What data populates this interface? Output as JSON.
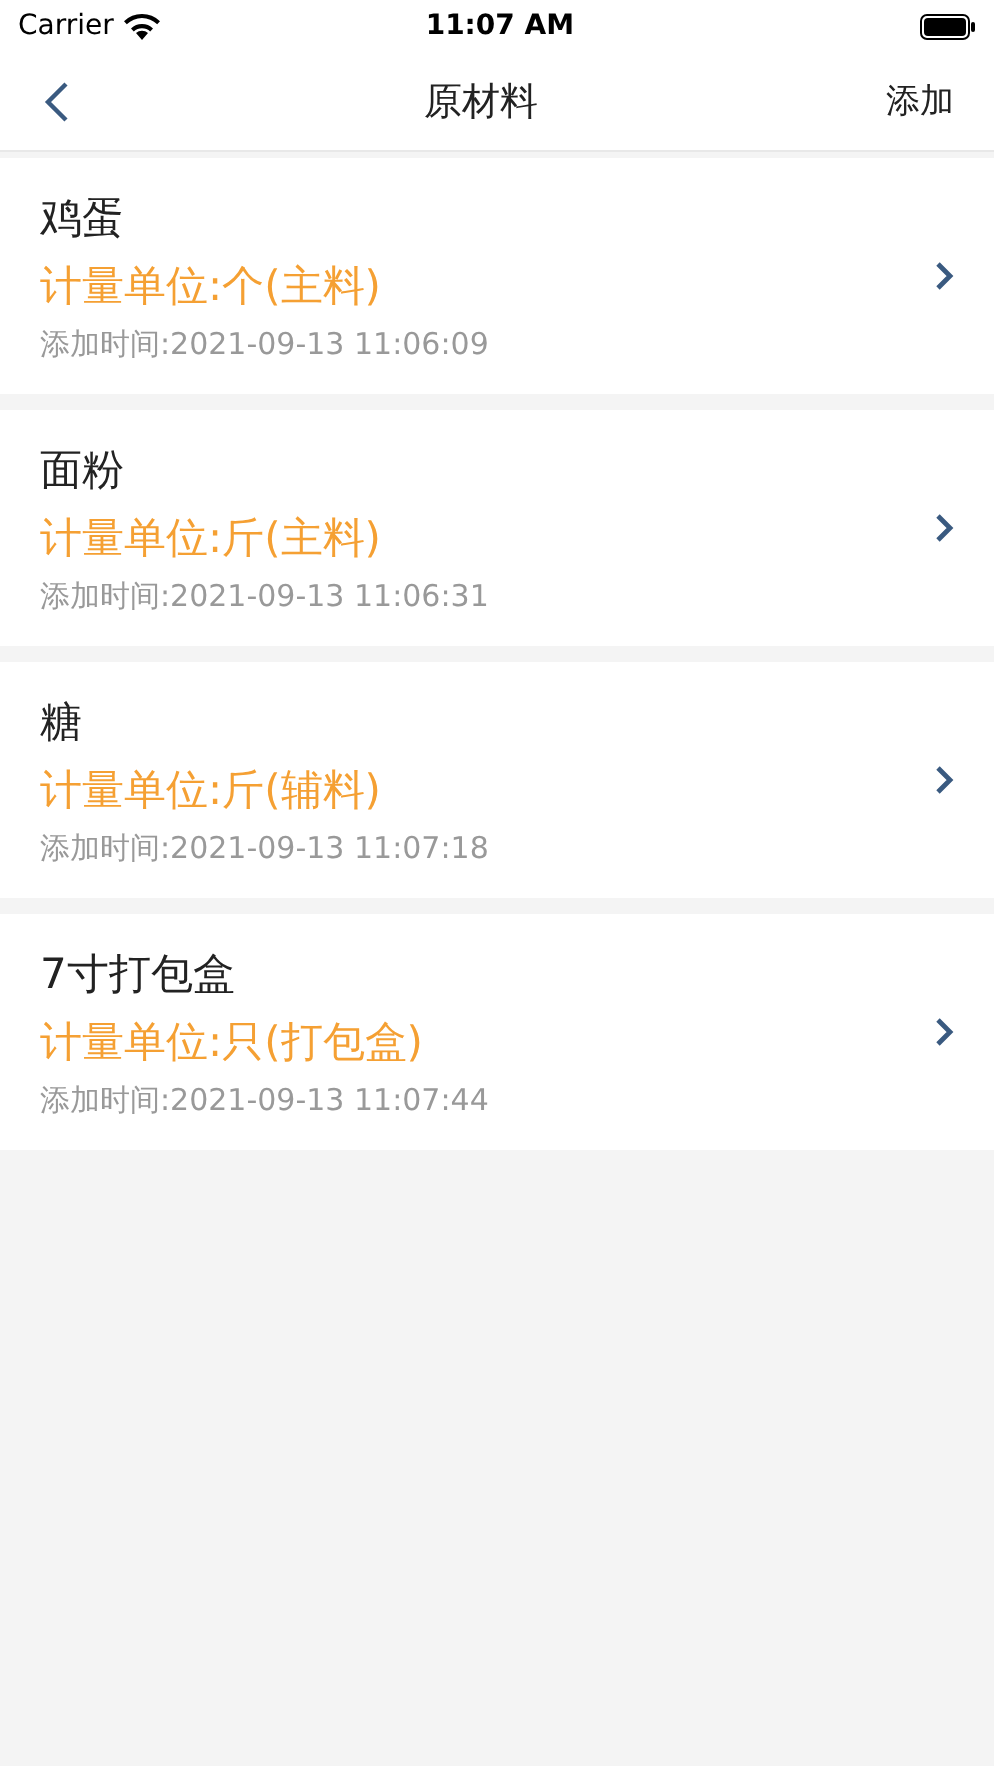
{
  "status_bar": {
    "carrier": "Carrier",
    "time": "11:07 AM"
  },
  "nav": {
    "title": "原材料",
    "action": "添加"
  },
  "items": [
    {
      "name": "鸡蛋",
      "unit": "计量单位:个(主料)",
      "time": "添加时间:2021-09-13 11:06:09"
    },
    {
      "name": "面粉",
      "unit": "计量单位:斤(主料)",
      "time": "添加时间:2021-09-13 11:06:31"
    },
    {
      "name": "糖",
      "unit": "计量单位:斤(辅料)",
      "time": "添加时间:2021-09-13 11:07:18"
    },
    {
      "name": "7寸打包盒",
      "unit": "计量单位:只(打包盒)",
      "time": "添加时间:2021-09-13 11:07:44"
    }
  ]
}
